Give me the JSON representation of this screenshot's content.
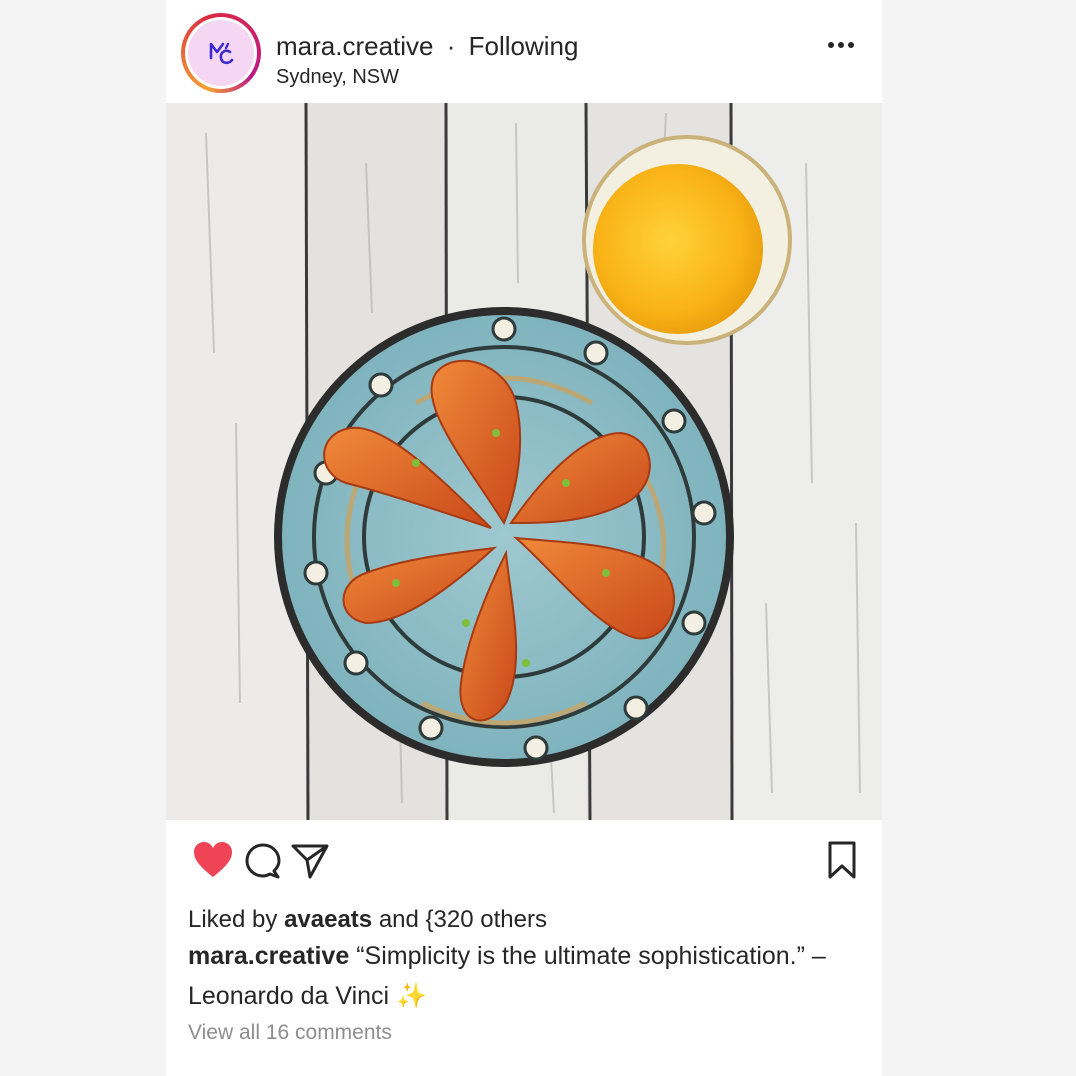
{
  "post": {
    "username": "mara.creative",
    "separator": "·",
    "follow_status": "Following",
    "location": "Sydney, NSW",
    "more_icon": "more-horizontal-icon",
    "image_subject": "food-photo",
    "liked_by_prefix": "Liked by",
    "liked_by_user": "avaeats",
    "liked_by_suffix": "and {320 others",
    "caption_user": "mara.creative",
    "caption_text": "“Simplicity is the ultimate sophistication.” – Leonardo da Vinci ✨",
    "view_comments": "View all 16 comments",
    "liked": true,
    "colors": {
      "heart": "#ef4456",
      "text": "#262626",
      "muted": "#8e8e8e",
      "avatar_bg": "#f6d7f3",
      "avatar_logo": "#3b2ccf"
    }
  }
}
